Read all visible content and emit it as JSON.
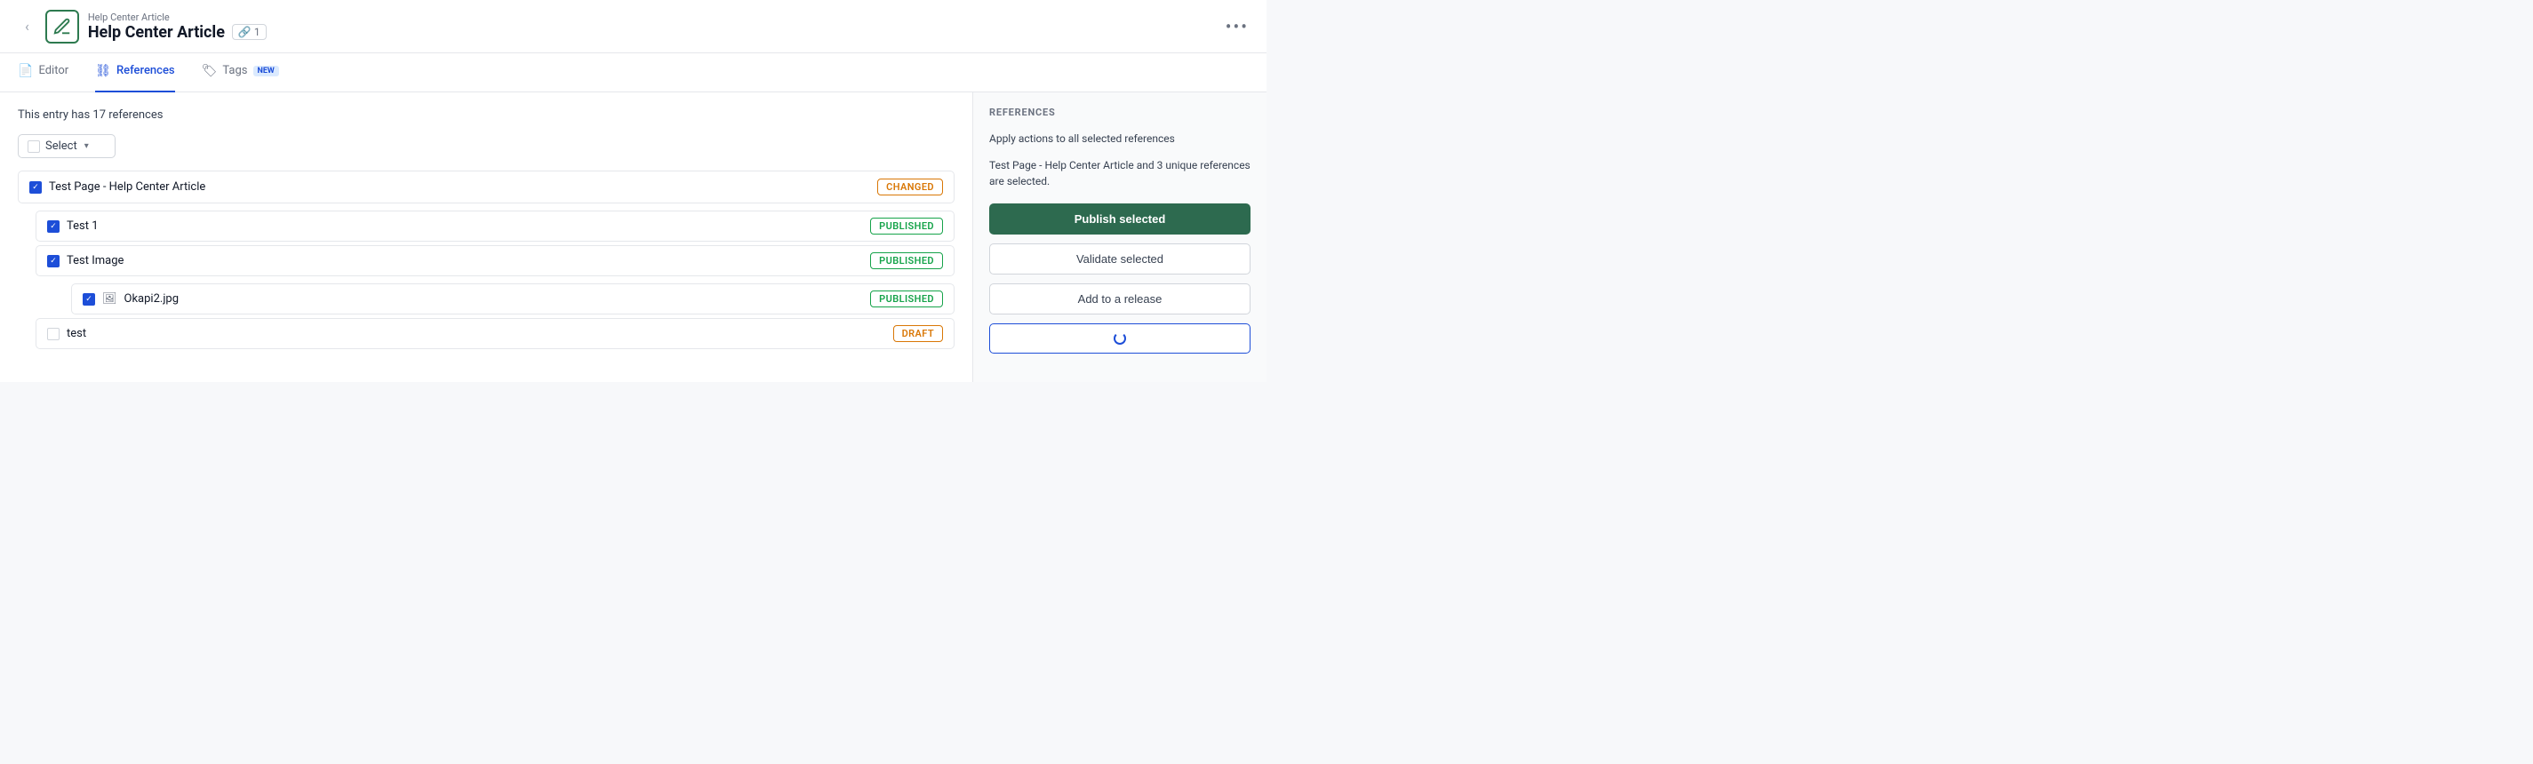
{
  "header": {
    "back_label": "‹",
    "subtitle": "Help Center Article",
    "title": "Help Center Article",
    "link_icon": "🔗",
    "link_count": "1",
    "more_icon": "•••"
  },
  "tabs": {
    "editor": "Editor",
    "references": "References",
    "tags": "Tags",
    "new_badge": "NEW"
  },
  "content": {
    "references_count": "This entry has 17 references",
    "select_label": "Select",
    "items": [
      {
        "label": "Test Page - Help Center Article",
        "status": "CHANGED",
        "checked": true,
        "children": [
          {
            "label": "Test 1",
            "status": "PUBLISHED",
            "checked": true,
            "children": []
          },
          {
            "label": "Test Image",
            "status": "PUBLISHED",
            "checked": true,
            "children": [
              {
                "label": "Okapi2.jpg",
                "status": "PUBLISHED",
                "checked": true,
                "isImage": true
              }
            ]
          },
          {
            "label": "test",
            "status": "DRAFT",
            "checked": false,
            "children": []
          }
        ]
      }
    ]
  },
  "sidebar": {
    "title": "REFERENCES",
    "apply_actions_label": "Apply actions to all selected references",
    "selection_info": "Test Page - Help Center Article and 3 unique references are selected.",
    "publish_selected_label": "Publish selected",
    "validate_selected_label": "Validate selected",
    "add_to_release_label": "Add to a release",
    "loading_label": ""
  }
}
